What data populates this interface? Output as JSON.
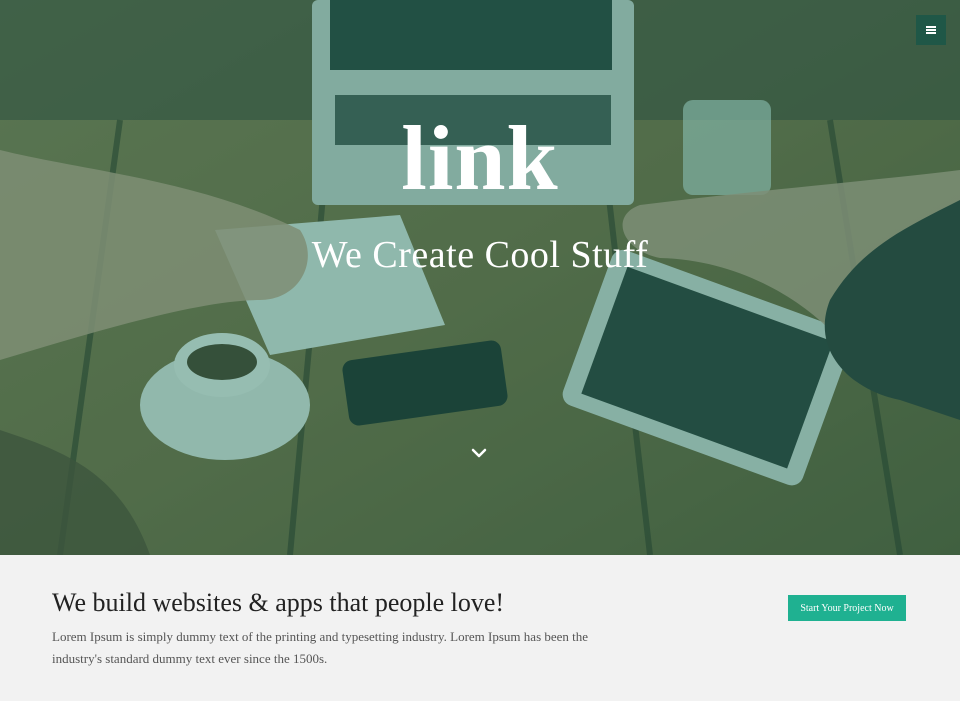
{
  "hero": {
    "brand": "link",
    "tagline": "We Create Cool Stuff",
    "overlay_color": "#187058",
    "menu_icon": "hamburger-menu-icon",
    "scroll_icon": "chevron-down-icon"
  },
  "cta": {
    "heading": "We build websites & apps that people love!",
    "text": "Lorem Ipsum is simply dummy text of the printing and typesetting industry. Lorem Ipsum has been the industry's standard dummy text ever since the 1500s.",
    "button_label": "Start Your Project Now",
    "button_color": "#1fb191"
  }
}
